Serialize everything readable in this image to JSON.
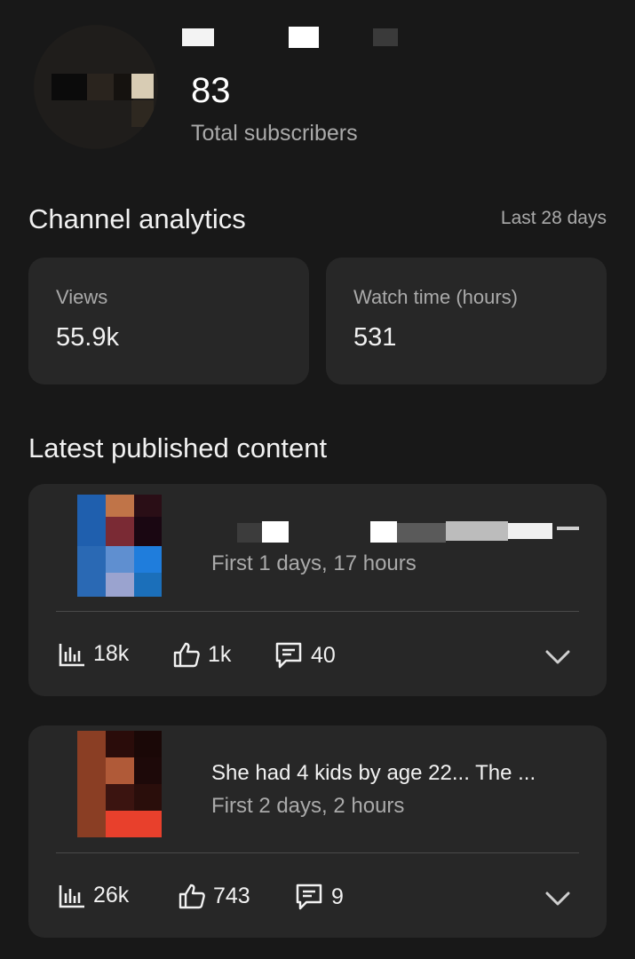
{
  "header": {
    "subscriber_count": "83",
    "subscriber_label": "Total subscribers"
  },
  "analytics": {
    "title": "Channel analytics",
    "range": "Last 28 days",
    "cards": [
      {
        "label": "Views",
        "value": "55.9k"
      },
      {
        "label": "Watch time (hours)",
        "value": "531"
      }
    ]
  },
  "latest": {
    "title": "Latest published content",
    "items": [
      {
        "title": "",
        "age": "First 1 days, 17 hours",
        "views": "18k",
        "likes": "1k",
        "comments": "40"
      },
      {
        "title": "She had 4 kids by age 22... The ...",
        "age": "First 2 days, 2 hours",
        "views": "26k",
        "likes": "743",
        "comments": "9"
      }
    ]
  },
  "icons": {
    "views": "bar-chart-icon",
    "likes": "thumbs-up-icon",
    "comments": "comment-icon",
    "expand": "chevron-down-icon"
  },
  "colors": {
    "background": "#181818",
    "card": "#272727",
    "text_primary": "#f1f1f1",
    "text_secondary": "#aaaaaa"
  }
}
